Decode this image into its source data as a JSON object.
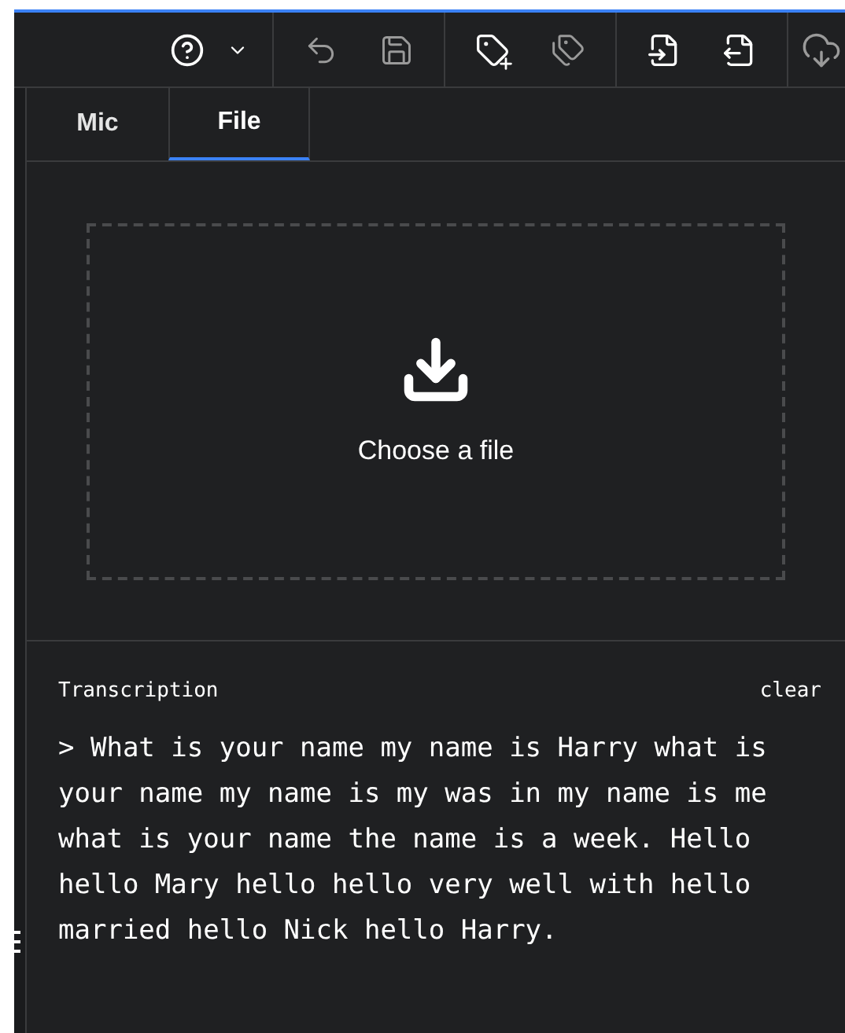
{
  "toolbar": {
    "help_menu": {
      "expanded": false
    }
  },
  "tabs": [
    {
      "label": "Mic",
      "selected": false
    },
    {
      "label": "File",
      "selected": true
    }
  ],
  "upload": {
    "label": "Choose a file"
  },
  "transcription": {
    "title": "Transcription",
    "clear": "clear",
    "text": "> What is your name my name is Harry what is your name my name is my was in my name is me what is your name the name is a week. Hello hello Mary hello hello very well with hello married hello Nick hello Harry."
  }
}
